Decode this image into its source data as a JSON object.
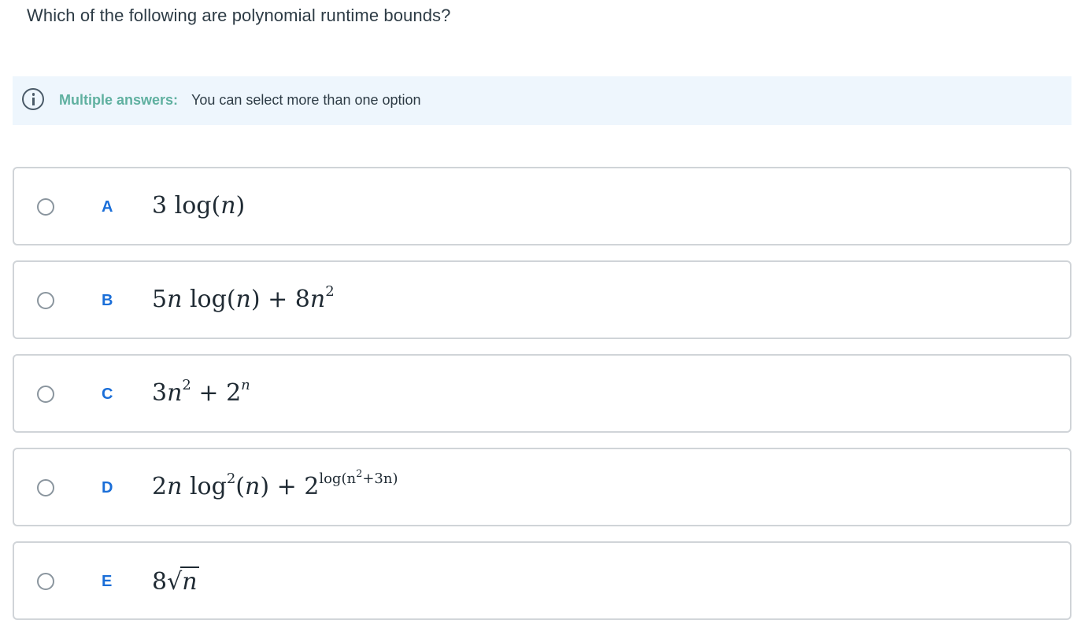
{
  "question": {
    "text": "Which of the following are polynomial runtime bounds?"
  },
  "info": {
    "icon": "info-icon",
    "title": "Multiple answers:",
    "text": "You can select more than one option",
    "accent_color": "#5fb0a0",
    "background_color": "#eef6fd"
  },
  "options": [
    {
      "letter": "A",
      "selected": false
    },
    {
      "letter": "B",
      "selected": false
    },
    {
      "letter": "C",
      "selected": false
    },
    {
      "letter": "D",
      "selected": false
    },
    {
      "letter": "E",
      "selected": false
    }
  ],
  "math": {
    "a": {
      "coef": "3",
      "func": "log(",
      "var": "n",
      "close": ")"
    },
    "b": {
      "p1": "5",
      "v1": "n",
      "p2": " log(",
      "v2": "n",
      "p3": ") + 8",
      "v3": "n",
      "exp": "2"
    },
    "c": {
      "p1": "3",
      "v1": "n",
      "exp1": "2",
      "p2": " + 2",
      "exp2": "n"
    },
    "d": {
      "p1": "2",
      "v1": "n",
      "p2": " log",
      "exp1": "2",
      "p3": "(",
      "v2": "n",
      "p4": ") + 2",
      "exp_base": "log(n",
      "exp_sq": "2",
      "exp_rest": "+3n)"
    },
    "e": {
      "coef": "8",
      "radical": "√",
      "var": "n"
    }
  },
  "colors": {
    "letter": "#1a6ed8",
    "option_border": "#d0d4d8",
    "text": "#2d3b45"
  }
}
